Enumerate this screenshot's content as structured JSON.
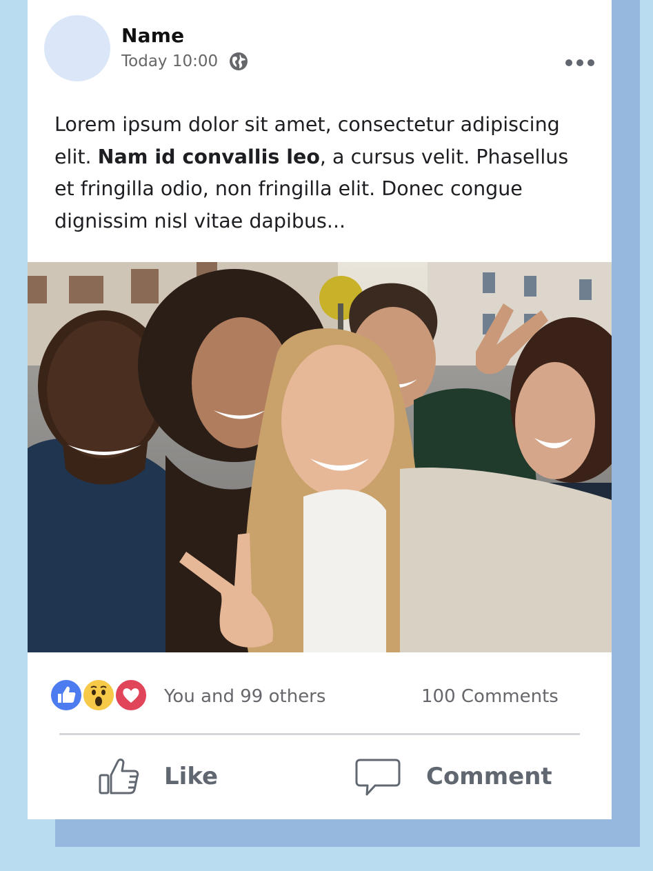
{
  "post": {
    "author_name": "Name",
    "timestamp": "Today 10:00",
    "privacy_icon": "globe-icon",
    "more_icon": "more-options-icon",
    "text": {
      "part1": "Lorem ipsum dolor sit amet, consectetur adipiscing elit. ",
      "bold": "Nam id convallis leo",
      "part2": ", a cursus velit. Phasellus et fringilla odio, non fringilla elit. Donec congue dignissim nisl vitae dapibus..."
    },
    "photo_alt": "Group selfie of five smiling friends on a city street"
  },
  "reactions": {
    "icons": [
      "like-reaction-icon",
      "wow-reaction-icon",
      "love-reaction-icon"
    ],
    "summary": "You and 99 others",
    "comments": "100 Comments"
  },
  "actions": {
    "like_label": "Like",
    "comment_label": "Comment"
  },
  "colors": {
    "page_background": "#b9dcf0",
    "card_shadow": "#97b8de",
    "avatar": "#dbe7f9",
    "like_blue": "#4c7cf0",
    "love_red": "#e0455a",
    "wow_yellow": "#f7c948"
  }
}
